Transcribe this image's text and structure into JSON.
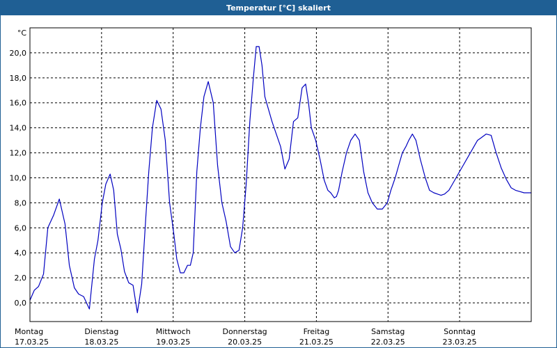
{
  "window": {
    "title": "Temperatur [°C] skaliert"
  },
  "chart_data": {
    "type": "line",
    "unit_label": "°C",
    "ylim": [
      -1.5,
      22.0
    ],
    "xlim": [
      0,
      7
    ],
    "y_ticks": [
      {
        "value": 0,
        "label": "0,0"
      },
      {
        "value": 2,
        "label": "2,0"
      },
      {
        "value": 4,
        "label": "4,0"
      },
      {
        "value": 6,
        "label": "6,0"
      },
      {
        "value": 8,
        "label": "8,0"
      },
      {
        "value": 10,
        "label": "10,0"
      },
      {
        "value": 12,
        "label": "12,0"
      },
      {
        "value": 14,
        "label": "14,0"
      },
      {
        "value": 16,
        "label": "16,0"
      },
      {
        "value": 18,
        "label": "18,0"
      },
      {
        "value": 20,
        "label": "20,0"
      }
    ],
    "x_ticks": [
      {
        "value": 0,
        "day": "Montag",
        "date": "17.03.25"
      },
      {
        "value": 1,
        "day": "Dienstag",
        "date": "18.03.25"
      },
      {
        "value": 2,
        "day": "Mittwoch",
        "date": "19.03.25"
      },
      {
        "value": 3,
        "day": "Donnerstag",
        "date": "20.03.25"
      },
      {
        "value": 4,
        "day": "Freitag",
        "date": "21.03.25"
      },
      {
        "value": 5,
        "day": "Samstag",
        "date": "22.03.25"
      },
      {
        "value": 6,
        "day": "Sonntag",
        "date": "23.03.25"
      }
    ],
    "grid": true,
    "series": [
      {
        "color": "#0000c0",
        "x": [
          0,
          0.06,
          0.12,
          0.19,
          0.25,
          0.33,
          0.41,
          0.49,
          0.55,
          0.62,
          0.68,
          0.75,
          0.83,
          0.9,
          0.95,
          1.01,
          1.06,
          1.12,
          1.17,
          1.22,
          1.27,
          1.32,
          1.38,
          1.44,
          1.5,
          1.56,
          1.62,
          1.66,
          1.71,
          1.77,
          1.83,
          1.89,
          1.95,
          2.01,
          2.05,
          2.1,
          2.15,
          2.2,
          2.24,
          2.28,
          2.33,
          2.38,
          2.43,
          2.49,
          2.56,
          2.62,
          2.68,
          2.74,
          2.8,
          2.86,
          2.92,
          2.97,
          3.02,
          3.07,
          3.12,
          3.16,
          3.2,
          3.24,
          3.28,
          3.33,
          3.38,
          3.44,
          3.5,
          3.56,
          3.62,
          3.68,
          3.74,
          3.8,
          3.85,
          3.89,
          3.93,
          3.99,
          4.05,
          4.11,
          4.16,
          4.2,
          4.25,
          4.28,
          4.31,
          4.36,
          4.42,
          4.48,
          4.54,
          4.6,
          4.66,
          4.72,
          4.78,
          4.85,
          4.92,
          4.99,
          5.04,
          5.1,
          5.15,
          5.2,
          5.25,
          5.29,
          5.34,
          5.39,
          5.45,
          5.52,
          5.58,
          5.64,
          5.69,
          5.74,
          5.79,
          5.85,
          5.9,
          5.95,
          6.0,
          6.05,
          6.1,
          6.15,
          6.2,
          6.25,
          6.3,
          6.37,
          6.44,
          6.51,
          6.58,
          6.65,
          6.72,
          6.78,
          6.84,
          6.9,
          6.95,
          7.0
        ],
        "y": [
          0.2,
          1.0,
          1.3,
          2.3,
          6.0,
          7.0,
          8.3,
          6.3,
          3.0,
          1.2,
          0.7,
          0.5,
          -0.5,
          3.5,
          5.0,
          8.0,
          9.5,
          10.3,
          9.0,
          5.5,
          4.3,
          2.5,
          1.6,
          1.4,
          -0.8,
          1.5,
          7.0,
          10.5,
          14.0,
          16.2,
          15.5,
          13.0,
          8.0,
          5.5,
          3.5,
          2.4,
          2.4,
          3.0,
          3.0,
          4.0,
          10.5,
          14.0,
          16.5,
          17.7,
          16.0,
          11.0,
          8.0,
          6.5,
          4.5,
          4.0,
          4.2,
          6.0,
          9.5,
          14.5,
          18.0,
          20.5,
          20.5,
          19.0,
          16.5,
          15.5,
          14.5,
          13.5,
          12.5,
          10.7,
          11.5,
          14.5,
          14.8,
          17.2,
          17.5,
          16.0,
          14.0,
          13.0,
          11.5,
          9.8,
          9.0,
          8.8,
          8.4,
          8.5,
          9.0,
          10.5,
          12.0,
          13.0,
          13.5,
          13.0,
          10.5,
          8.8,
          8.0,
          7.5,
          7.5,
          8.0,
          9.0,
          10.0,
          11.0,
          12.0,
          12.5,
          13.0,
          13.5,
          13.0,
          11.5,
          10.0,
          9.0,
          8.8,
          8.7,
          8.6,
          8.7,
          9.0,
          9.5,
          10.0,
          10.5,
          11.0,
          11.5,
          12.0,
          12.5,
          13.0,
          13.2,
          13.5,
          13.4,
          12.0,
          10.8,
          9.9,
          9.2,
          9.0,
          8.9,
          8.8,
          8.8,
          8.8
        ]
      }
    ]
  }
}
